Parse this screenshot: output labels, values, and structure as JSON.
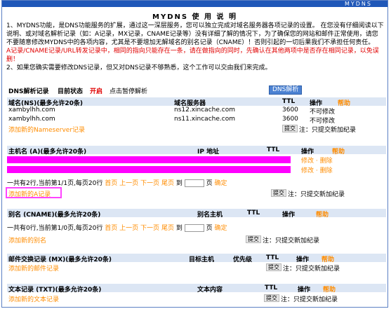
{
  "brand": "MYDNS",
  "title": "MYDNS 使 用 说 明",
  "notice": {
    "p1": "1、MYDNS功能，是DNS功能服务的扩展，通过这一深层服务，您可以独立完成对域名服务器各项记录的设置。 在您没有仔细阅读以下说明、或对域名解析记录（如：A记录，MX记录，CNAME记录等）没有详细了解的情况下，为了确保您的网站和邮件正常使用，请您不要随意修改MYDNS中的各项内容，尤其是不要增加无解域名的别名记录（CNAME）！否则引起的一切后果我们不承担任何责任。",
    "warn": "A记录/CNAME记录/URL转发记录中，相同的指向只能存在一条，请在做指向的同时，先确认在其他两项中是否存在相同记录，以免误删！",
    "p2": "2、如果您确实需要修改DNS记录，但又对DNS记录不够熟悉，这个工作可以交由我们来完成。"
  },
  "status": {
    "label1": "DNS解析记录",
    "label2": "目前状态",
    "state": "开启",
    "pause": "点击暂停解析",
    "dns_button": "DNS解析"
  },
  "ns": {
    "headers": [
      "域名(NS)(最多允许20条)",
      "域名服务器",
      "TTL",
      "操作",
      "帮助"
    ],
    "rows": [
      {
        "domain": "xambylhh.com",
        "server": "ns12.xincache.com",
        "ttl": "3600",
        "op": "不可修改"
      },
      {
        "domain": "xambylhh.com",
        "server": "ns11.xincache.com",
        "ttl": "3600",
        "op": "不可修改"
      }
    ],
    "add_link": "添加新的Nameserver记录",
    "submit": "提交",
    "note": "注：只提交新加纪录"
  },
  "a": {
    "headers": [
      "主机名 (A)(最多允许20条)",
      "IP 地址",
      "TTL",
      "操作",
      "帮助"
    ],
    "rows": [
      {
        "edit": "修改",
        "del": "删除"
      },
      {
        "edit": "修改",
        "del": "删除"
      }
    ],
    "pager": {
      "summary": "一共有2行,当前第1/1页,每页20行",
      "first": "首页",
      "prev": "上一页",
      "next": "下一页",
      "last": "尾页",
      "to": "到",
      "page": "页",
      "confirm": "确定"
    },
    "add_link": "添加新的A记录",
    "submit": "提交",
    "note": "注：只提交新加纪录"
  },
  "cname": {
    "headers": [
      "别名 (CNAME)(最多允许20条)",
      "别名主机",
      "TTL",
      "操作",
      "帮助"
    ],
    "pager": {
      "summary": "一共有0行,当前第1/0页,每页20行",
      "first": "首页",
      "prev": "上一页",
      "next": "下一页",
      "last": "尾页",
      "to": "到",
      "page": "页",
      "confirm": "确定"
    },
    "add_link": "添加新的别名",
    "submit": "提交",
    "note": "注：只提交新加纪录"
  },
  "mx": {
    "headers": [
      "邮件交换记录 (MX)(最多允许20条)",
      "目标主机",
      "优先级",
      "TTL",
      "操作",
      "帮助"
    ],
    "add_link": "添加新的邮件记录",
    "submit": "提交",
    "note": "注：只提交新加纪录"
  },
  "txt": {
    "headers": [
      "文本记录 (TXT)(最多允许20条)",
      "文本内容",
      "TTL",
      "操作",
      "帮助"
    ],
    "add_link": "添加新的文本记录",
    "submit": "提交",
    "note": "注：只提交新加纪录"
  },
  "colors": {
    "accent": "#1f57b8",
    "link": "#ff8c00",
    "warn": "#e00000",
    "highlight": "#ff00ff",
    "header_bg": "#dce6f4"
  }
}
